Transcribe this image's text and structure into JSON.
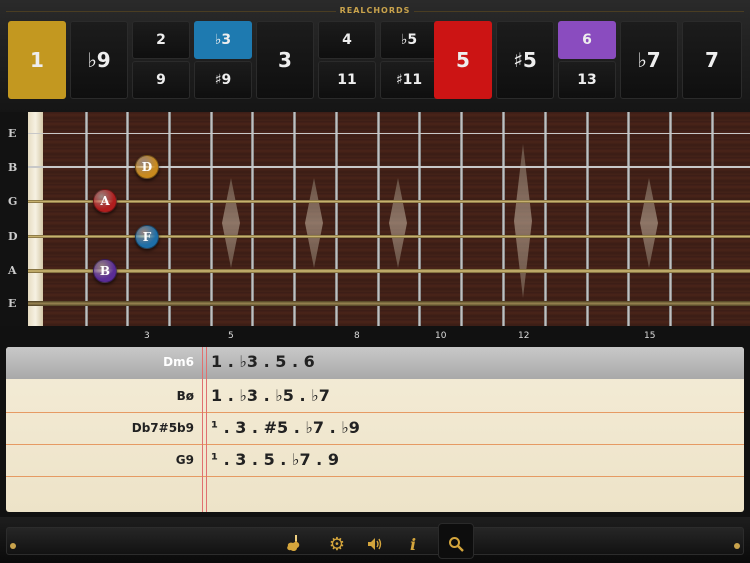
{
  "app_title": "REALCHORDS",
  "interval_keys": [
    {
      "id": "1",
      "label": "1",
      "active": true,
      "color": "#c39820"
    },
    {
      "id": "b9",
      "label": "♭9",
      "active": false
    },
    {
      "id": "2",
      "label": "2",
      "active": false
    },
    {
      "id": "9",
      "label": "9",
      "active": false
    },
    {
      "id": "b3",
      "label": "♭3",
      "active": true,
      "color": "#1e7ab0"
    },
    {
      "id": "s9",
      "label": "♯9",
      "active": false
    },
    {
      "id": "3",
      "label": "3",
      "active": false
    },
    {
      "id": "4",
      "label": "4",
      "active": false
    },
    {
      "id": "11",
      "label": "11",
      "active": false
    },
    {
      "id": "b5",
      "label": "♭5",
      "active": false
    },
    {
      "id": "s11",
      "label": "♯11",
      "active": false
    },
    {
      "id": "5",
      "label": "5",
      "active": true,
      "color": "#cc1414"
    },
    {
      "id": "s5",
      "label": "♯5",
      "active": false
    },
    {
      "id": "6",
      "label": "6",
      "active": true,
      "color": "#8a4cbf"
    },
    {
      "id": "13",
      "label": "13",
      "active": false
    },
    {
      "id": "b7",
      "label": "♭7",
      "active": false
    },
    {
      "id": "7",
      "label": "7",
      "active": false
    }
  ],
  "strings": [
    "E",
    "B",
    "G",
    "D",
    "A",
    "E"
  ],
  "notes": [
    {
      "label": "D",
      "string": "B",
      "fret": 3,
      "color": "#c98a1e"
    },
    {
      "label": "A",
      "string": "G",
      "fret": 2,
      "color": "#b01e1e"
    },
    {
      "label": "F",
      "string": "D",
      "fret": 3,
      "color": "#1e6fa8"
    },
    {
      "label": "B",
      "string": "A",
      "fret": 2,
      "color": "#5a2c96"
    }
  ],
  "fret_numbers": [
    "3",
    "5",
    "8",
    "10",
    "12",
    "15"
  ],
  "chords": [
    {
      "name": "Dm6",
      "formula": "1 . ♭3 . 5 . 6",
      "selected": true
    },
    {
      "name": "Bø",
      "formula": "1 . ♭3 . ♭5 . ♭7",
      "selected": false
    },
    {
      "name": "Db7#5b9",
      "formula": "¹ . 3 . #5 . ♭7 . ♭9",
      "selected": false
    },
    {
      "name": "G9",
      "formula": "¹ . 3 . 5 . ♭7 . 9",
      "selected": false
    }
  ],
  "toolbar": {
    "guitar_icon": "guitar-icon",
    "settings_icon": "gear-icon",
    "sound_icon": "speaker-icon",
    "info_icon": "info-icon",
    "search_icon": "search-icon"
  },
  "colors": {
    "accent": "#c9a34c"
  }
}
